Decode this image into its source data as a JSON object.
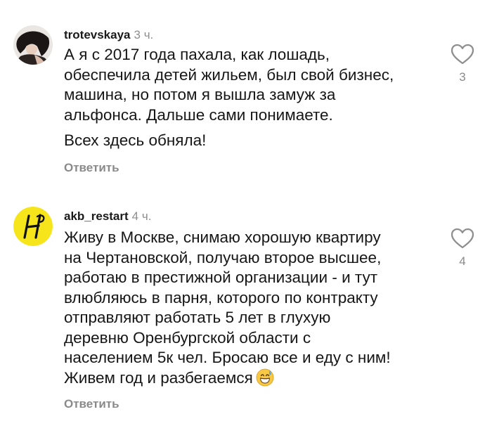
{
  "comments": [
    {
      "username": "trotevskaya",
      "time": "3 ч.",
      "lines": [
        "А я с 2017 года пахала, как лошадь,",
        "обеспечила детей жильем, был свой бизнес,",
        "машина, но потом я вышла замуж за",
        "альфонса. Дальше сами понимаете."
      ],
      "paragraph2": "Всех здесь обняла!",
      "reply_label": "Ответить",
      "likes": "3",
      "like_icon": "heart-outline-icon"
    },
    {
      "username": "akb_restart",
      "time": "4 ч.",
      "lines": [
        "Живу в Москве, снимаю хорошую квартиру",
        "на Чертановской, получаю второе высшее,",
        "работаю в престижной организации - и тут",
        "влюбляюсь в парня, которого по контракту",
        "отправляют работать 5 лет в глухую",
        "деревню Оренбургской области с",
        "населением 5к чел. Бросаю все и еду с ним!",
        "Живем год и разбегаемся"
      ],
      "reply_label": "Ответить",
      "likes": "4",
      "like_icon": "heart-outline-icon",
      "avatar_logo_text": "H",
      "emoji_icon": "grinning-sweat-emoji-icon"
    }
  ],
  "colors": {
    "text": "#161616",
    "muted": "#8e8e8e",
    "logo_yellow": "#f5e51a"
  }
}
